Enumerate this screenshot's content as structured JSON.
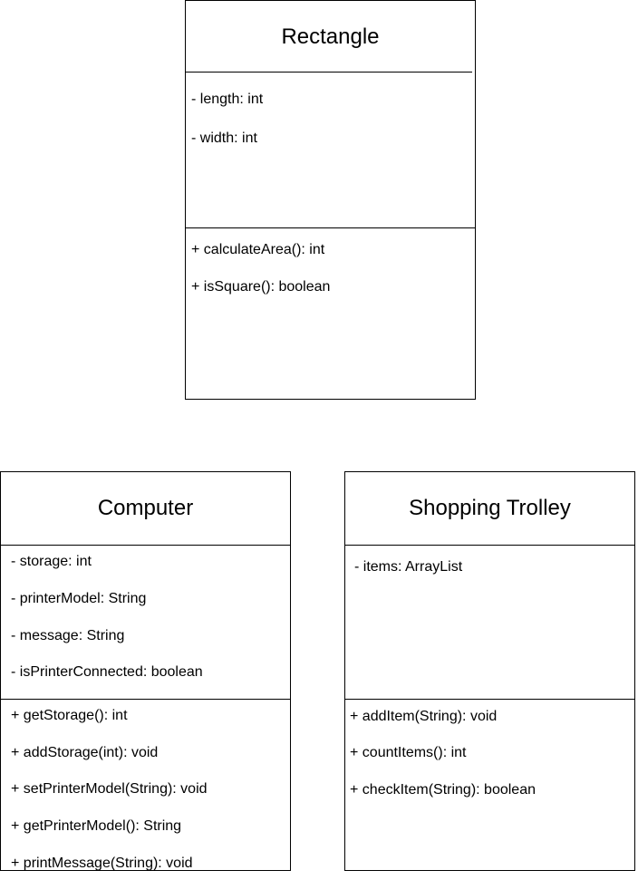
{
  "diagram": {
    "classes": [
      {
        "name": "Rectangle",
        "attributes": [
          "- length: int",
          "- width: int"
        ],
        "operations": [
          "+ calculateArea(): int",
          "+ isSquare(): boolean"
        ]
      },
      {
        "name": "Computer",
        "attributes": [
          "- storage: int",
          "- printerModel: String",
          "- message: String",
          "- isPrinterConnected: boolean"
        ],
        "operations": [
          "+ getStorage(): int",
          "+ addStorage(int): void",
          "+ setPrinterModel(String): void",
          "+ getPrinterModel(): String",
          "+ printMessage(String): void"
        ]
      },
      {
        "name": "Shopping Trolley",
        "attributes": [
          "- items: ArrayList"
        ],
        "operations": [
          "+ addItem(String): void",
          "+ countItems(): int",
          "+ checkItem(String): boolean"
        ]
      }
    ]
  }
}
